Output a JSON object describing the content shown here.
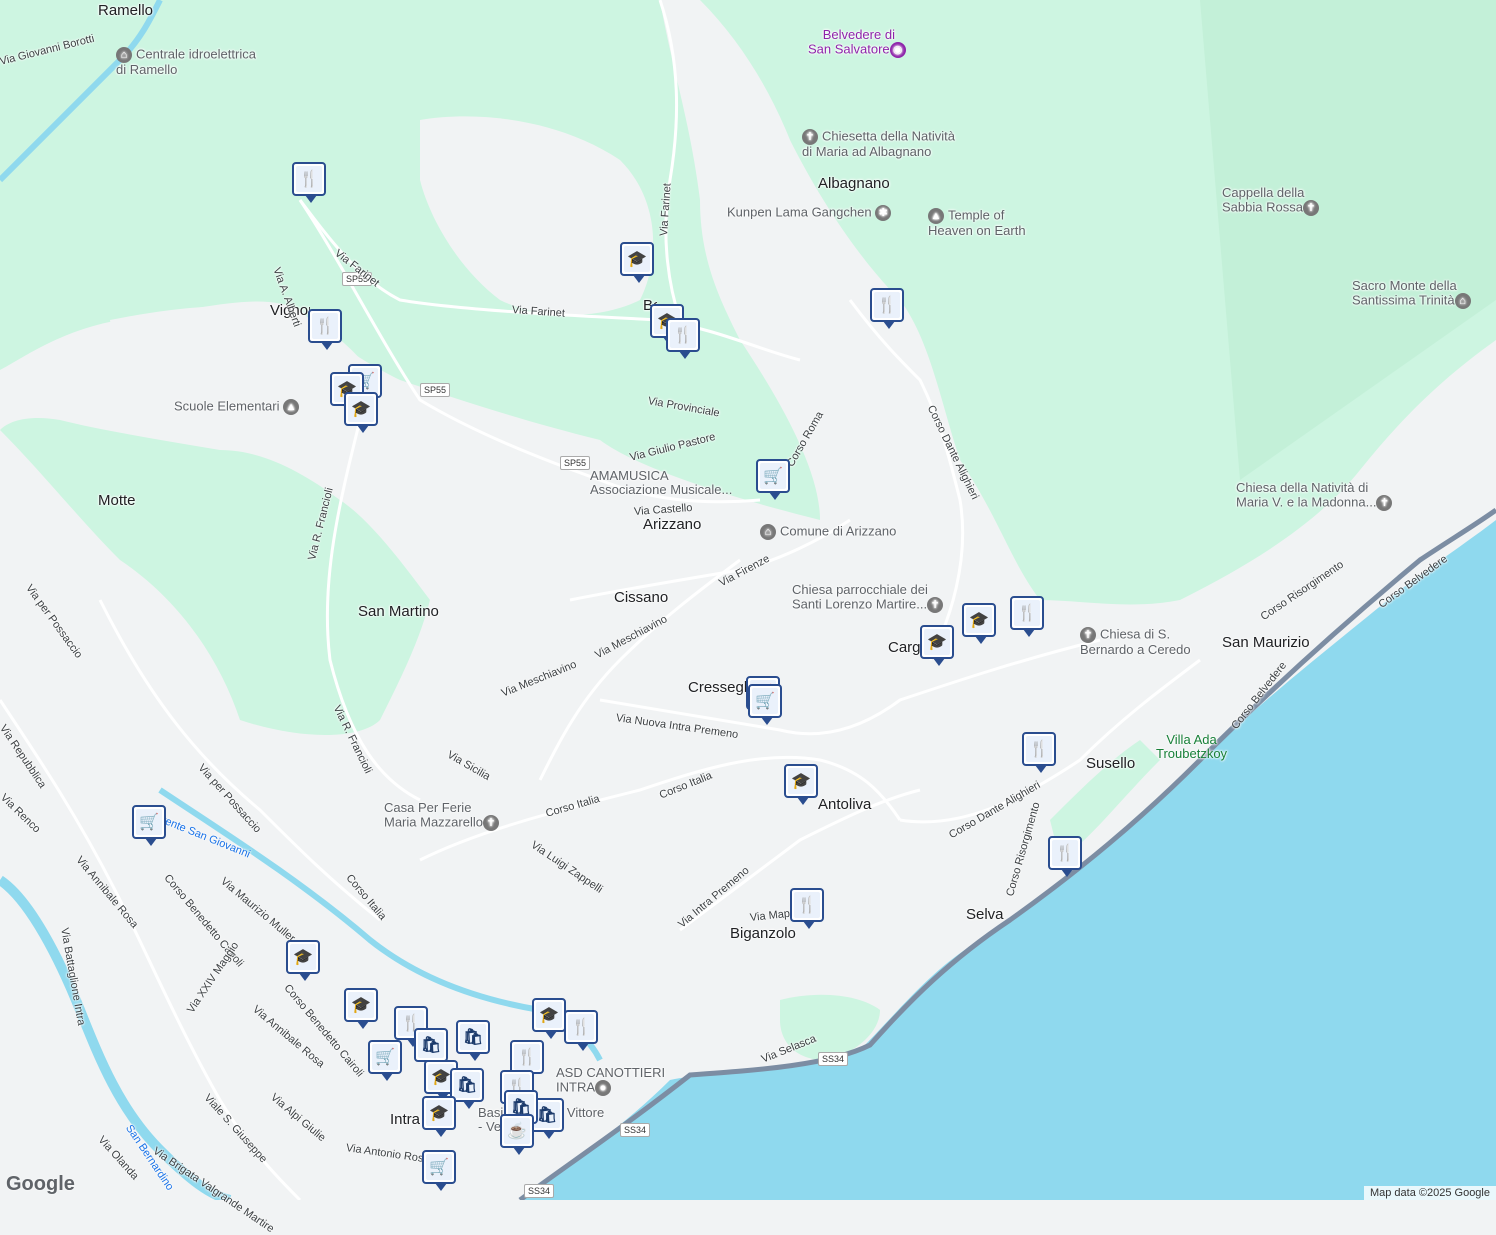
{
  "map": {
    "colors": {
      "land": "#f1f3f4",
      "forest": "#cdf5e1",
      "lake": "#8fd9ee",
      "river": "#8fd9ee",
      "road": "#ffffff",
      "highway": "#9aa0a6",
      "pin_border": "#2a4d8f"
    },
    "attribution": "Map data ©2025 Google",
    "logo": "Google",
    "towns": [
      "Ramello",
      "Vignone",
      "Motte",
      "San Martino",
      "Arizzano",
      "Cissano",
      "Cresseglio",
      "Albagnano",
      "Antoliva",
      "Biganzolo",
      "Selva",
      "Susello",
      "San Maurizio",
      "Cargiago",
      "Intra",
      "Bee"
    ],
    "pois": [
      {
        "name": "Centrale idroelettrica\ndi Ramello",
        "icon": "museum-icon"
      },
      {
        "name": "Belvedere di\nSan Salvatore",
        "icon": "camera-icon"
      },
      {
        "name": "Chiesetta della Natività\ndi Maria ad Albagnano",
        "icon": "church-icon"
      },
      {
        "name": "Kunpen Lama Gangchen",
        "icon": "temple-icon"
      },
      {
        "name": "Temple of\nHeaven on Earth",
        "icon": "school-icon"
      },
      {
        "name": "Cappella della\nSabbia Rossa",
        "icon": "church-icon"
      },
      {
        "name": "Sacro Monte della\nSantissima Trinità",
        "icon": "museum-icon"
      },
      {
        "name": "Scuole Elementari",
        "icon": "school-icon"
      },
      {
        "name": "AMAMUSICA\nAssociazione Musicale...",
        "icon": "school-icon"
      },
      {
        "name": "Comune di Arizzano",
        "icon": "museum-icon"
      },
      {
        "name": "Chiesa parrocchiale dei\nSanti Lorenzo Martire...",
        "icon": "church-icon"
      },
      {
        "name": "Chiesa di S.\nBernardo a Ceredo",
        "icon": "church-icon"
      },
      {
        "name": "Chiesa della Natività di\nMaria V. e la Madonna...",
        "icon": "church-icon"
      },
      {
        "name": "Villa Ada\nTroubetzkoy",
        "icon": "park-icon"
      },
      {
        "name": "Casa Per Ferie\nMaria Mazzarello",
        "icon": "church-icon"
      },
      {
        "name": "ASD CANOTTIERI\nINTRA",
        "icon": "place-icon"
      },
      {
        "name": "Basilica di San Vittore\n- Verbania",
        "icon": "church-icon"
      }
    ],
    "roads": [
      "Via Giovanni Borotti",
      "Via Farinet",
      "Via A. Alberti",
      "Via Provinciale",
      "Via Giulio Pastore",
      "Corso Roma",
      "Via Castello",
      "Via R. Francioli",
      "Corso Dante Alighieri",
      "Via Firenze",
      "Via per Possaccio",
      "Via Meschiavino",
      "Via Nuova Intra Premeno",
      "Via Sicilia",
      "Corso Italia",
      "Via Luigi Zappelli",
      "Via Intra Premeno",
      "Via Mapelli",
      "Corso Risorgimento",
      "Corso Belvedere",
      "Via Selasca",
      "Via Repubblica",
      "Via Renco",
      "Via Annibale Rosa",
      "Corso Benedetto Cairoli",
      "Via Maurizio Muller",
      "Via Battaglione Intra",
      "Via XXIV Maggio",
      "Viale S. Giuseppe",
      "Via Alpi Giulie",
      "Via Brigata Valgrande Martire",
      "Via Antonio Rosmini",
      "Via Olanda",
      "San Bernardino",
      "Torrente San Giovanni",
      "Corso Italia"
    ],
    "shields": [
      "SP55",
      "SP55",
      "SP55",
      "SS34",
      "SS34",
      "SS34"
    ]
  }
}
